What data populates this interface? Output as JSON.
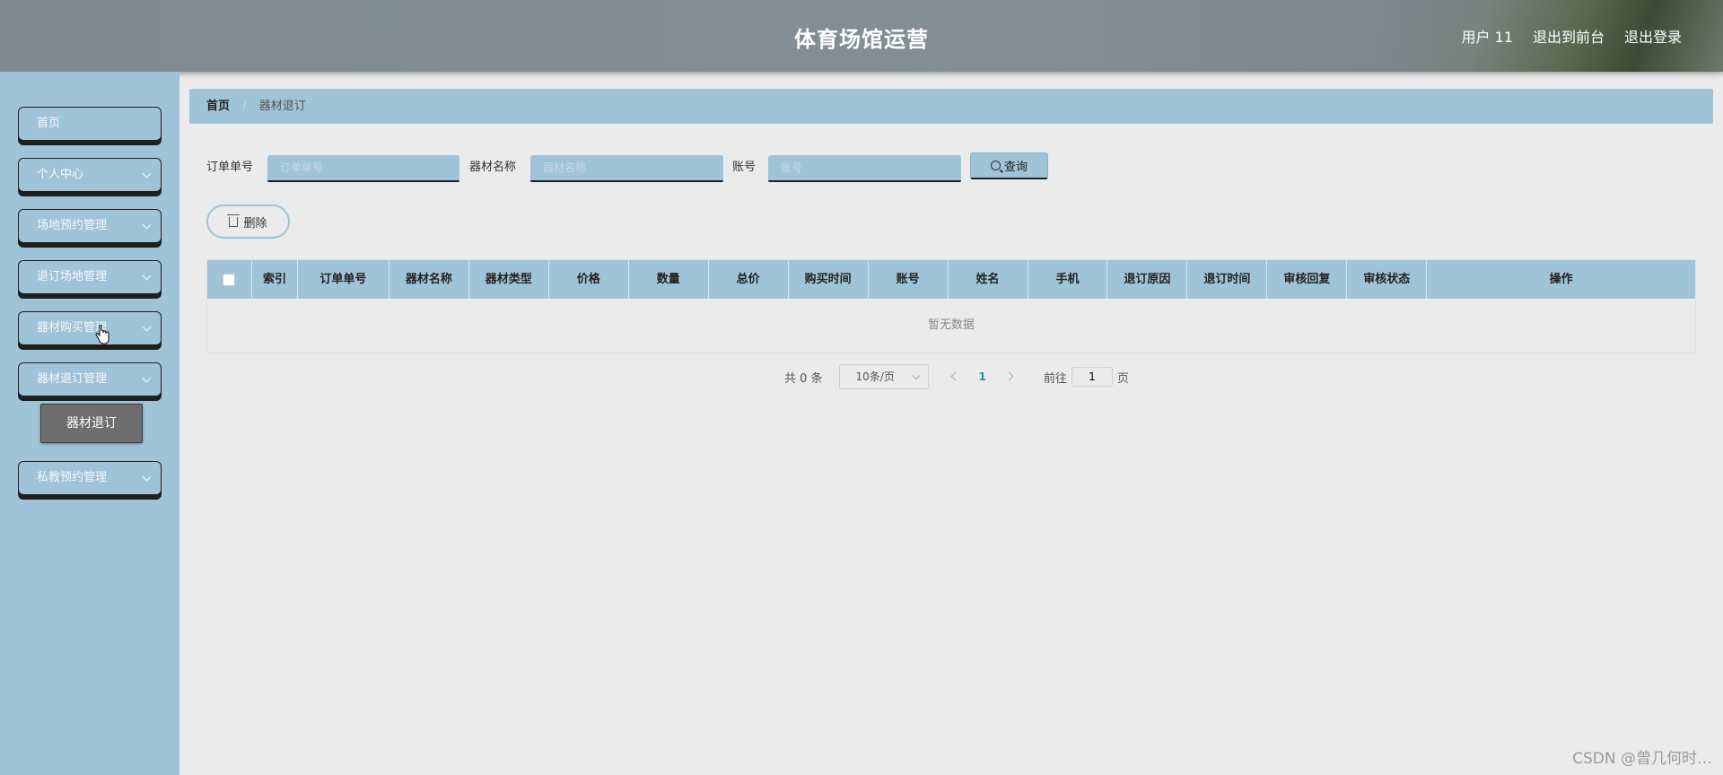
{
  "header": {
    "title": "体育场馆运营",
    "user": "用户 11",
    "back_to_front": "退出到前台",
    "logout": "退出登录"
  },
  "sidebar": {
    "items": [
      {
        "label": "首页",
        "has_children": false
      },
      {
        "label": "个人中心",
        "has_children": true
      },
      {
        "label": "场地预约管理",
        "has_children": true
      },
      {
        "label": "退订场地管理",
        "has_children": true
      },
      {
        "label": "器材购买管理",
        "has_children": true
      },
      {
        "label": "器材退订管理",
        "has_children": true
      },
      {
        "label": "私教预约管理",
        "has_children": true
      }
    ],
    "active_submenu": "器材退订"
  },
  "breadcrumb": {
    "home": "首页",
    "current": "器材退订"
  },
  "search": {
    "order_label": "订单单号",
    "order_placeholder": "订单单号",
    "equip_label": "器材名称",
    "equip_placeholder": "器材名称",
    "account_label": "账号",
    "account_placeholder": "账号",
    "query_label": "查询"
  },
  "actions": {
    "delete_label": "删除"
  },
  "table": {
    "columns": [
      "索引",
      "订单单号",
      "器材名称",
      "器材类型",
      "价格",
      "数量",
      "总价",
      "购买时间",
      "账号",
      "姓名",
      "手机",
      "退订原因",
      "退订时间",
      "审核回复",
      "审核状态",
      "操作"
    ],
    "empty_text": "暂无数据"
  },
  "pagination": {
    "total_text": "共 0 条",
    "page_size": "10条/页",
    "current_page": "1",
    "goto_prefix": "前往",
    "goto_value": "1",
    "goto_suffix": "页"
  },
  "watermark": "CSDN @曾几何时…"
}
